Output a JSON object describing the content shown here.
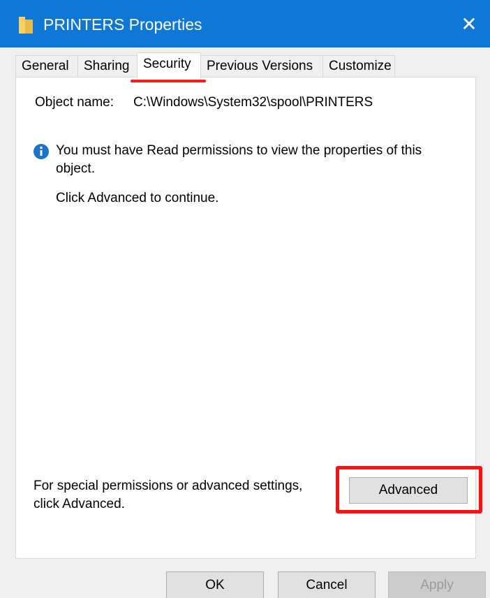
{
  "window": {
    "title": "PRINTERS Properties",
    "title_bar_color": "#0f78d7",
    "close_glyph": "✕"
  },
  "tabs": [
    {
      "label": "General",
      "active": false
    },
    {
      "label": "Sharing",
      "active": false
    },
    {
      "label": "Security",
      "active": true
    },
    {
      "label": "Previous Versions",
      "active": false
    },
    {
      "label": "Customize",
      "active": false
    }
  ],
  "security": {
    "object_name_label": "Object name:",
    "object_name_value": "C:\\Windows\\System32\\spool\\PRINTERS",
    "info_message": "You must have Read permissions to view the properties of this object.",
    "continue_message": "Click Advanced to continue.",
    "special_permissions_text": "For special permissions or advanced settings, click Advanced.",
    "advanced_label": "Advanced"
  },
  "buttons": {
    "ok": "OK",
    "cancel": "Cancel",
    "apply": "Apply"
  },
  "annotations": {
    "highlight_color": "#ff1010"
  }
}
